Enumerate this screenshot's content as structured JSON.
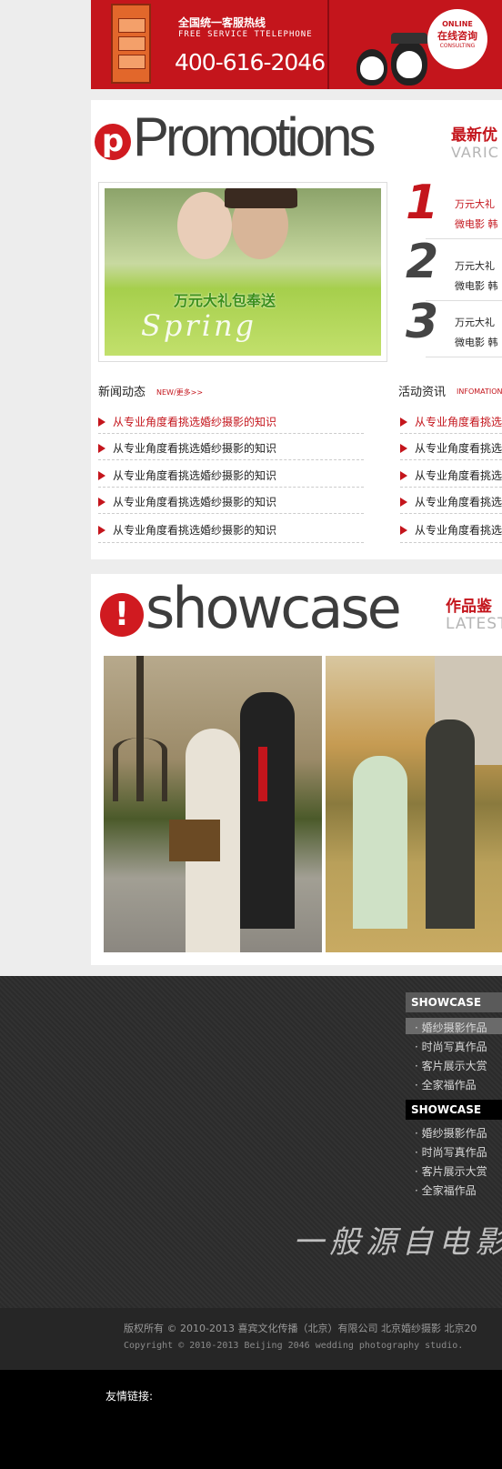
{
  "banner": {
    "hotline_title": "全国统一客服热线",
    "hotline_subtitle": "FREE SERVICE TTELEPHONE",
    "hotline_number": "400-616-2046",
    "online_en": "ONLINE",
    "online_cn": "在线咨询",
    "online_sub": "CONSULTING"
  },
  "promotions": {
    "heading": "Promotions",
    "heading_cn": "最新优",
    "heading_en": "VARIC",
    "photo_caption": "万元大礼包奉送",
    "photo_script": "Spring",
    "items": [
      {
        "number": "1",
        "line1": "万元大礼",
        "line2": "微电影 韩",
        "color": "#c4151c"
      },
      {
        "number": "2",
        "line1": "万元大礼",
        "line2": "微电影 韩",
        "color": "#444444"
      },
      {
        "number": "3",
        "line1": "万元大礼",
        "line2": "微电影 韩",
        "color": "#444444"
      }
    ]
  },
  "news": {
    "title": "新闻动态",
    "more": "NEW/更多>>",
    "items": [
      "从专业角度看挑选婚纱摄影的知识",
      "从专业角度看挑选婚纱摄影的知识",
      "从专业角度看挑选婚纱摄影的知识",
      "从专业角度看挑选婚纱摄影的知识",
      "从专业角度看挑选婚纱摄影的知识"
    ]
  },
  "activity": {
    "title": "活动资讯",
    "more": "INFOMATION/",
    "items": [
      "从专业角度看挑选",
      "从专业角度看挑选",
      "从专业角度看挑选",
      "从专业角度看挑选",
      "从专业角度看挑选"
    ]
  },
  "showcase": {
    "heading": "showcase",
    "heading_cn": "作品鉴",
    "heading_en": "LATEST"
  },
  "footer": {
    "menu1": {
      "title": "SHOWCASE",
      "items": [
        "婚纱摄影作品",
        "时尚写真作品",
        "客片展示大赏",
        "全家福作品"
      ]
    },
    "menu2": {
      "title": "SHOWCASE",
      "items": [
        "婚纱摄影作品",
        "时尚写真作品",
        "客片展示大赏",
        "全家福作品"
      ]
    },
    "calligraphy": "一般源自电影",
    "copyright_cn": "版权所有 © 2010-2013 喜宾文化传播（北京）有限公司 北京婚纱摄影 北京20",
    "copyright_en": "Copyright © 2010-2013 Beijing 2046 wedding photography studio.",
    "friends_label": "友情链接:"
  },
  "colors": {
    "accent": "#c4151c",
    "footer_bg": "#2b2b2b",
    "panel_bg": "#ffffff",
    "page_bg": "#ededed"
  }
}
